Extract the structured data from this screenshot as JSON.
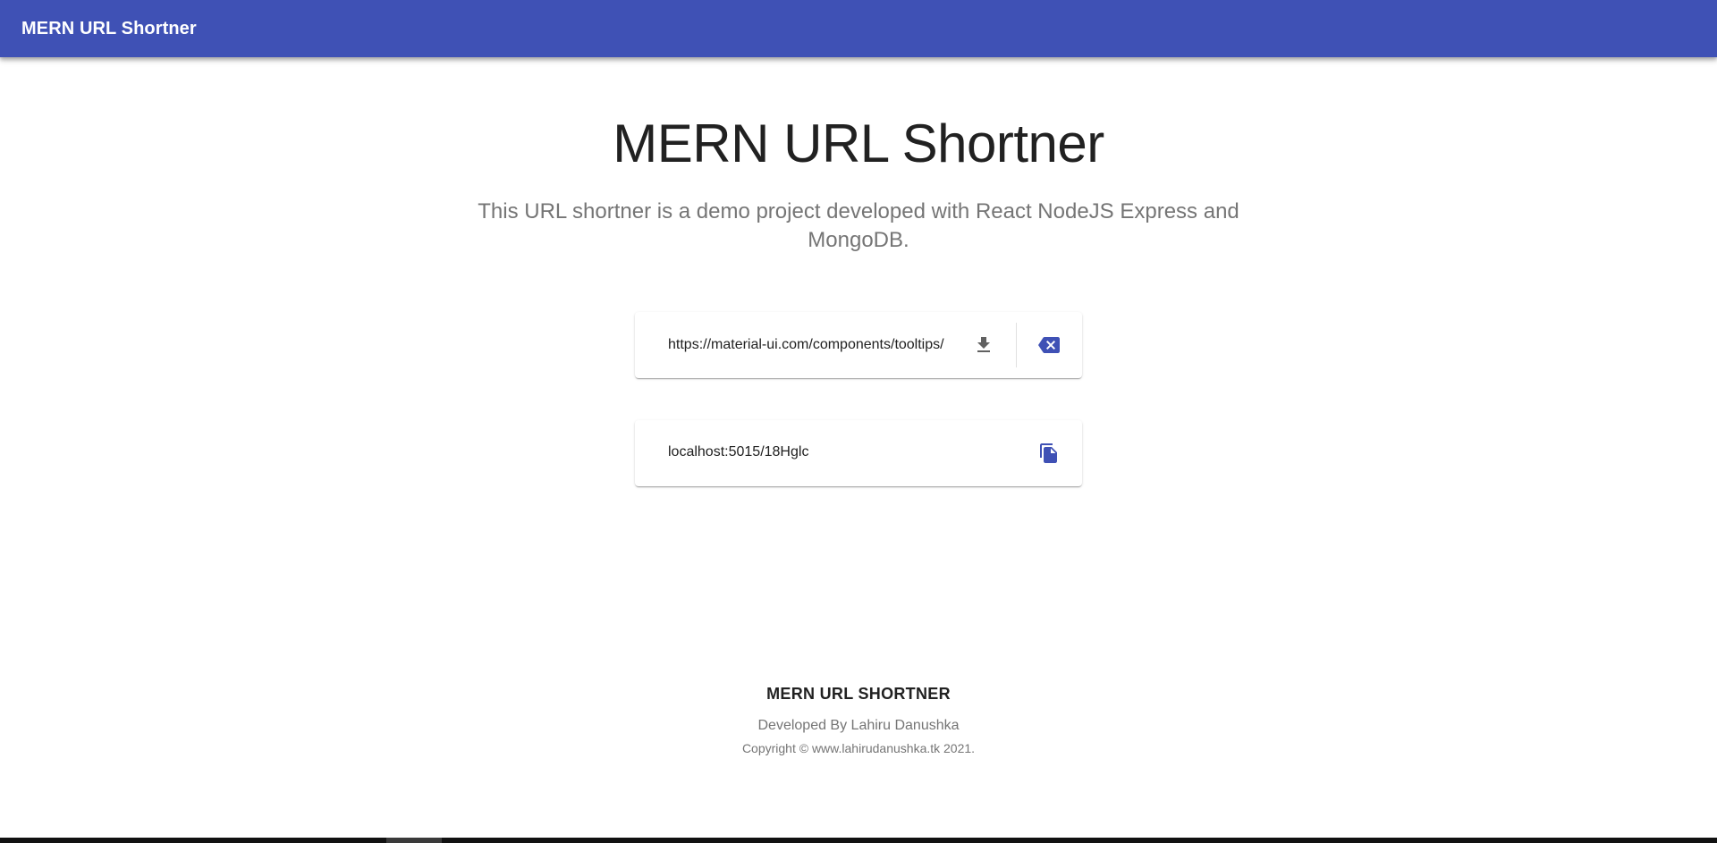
{
  "appbar": {
    "title": "MERN URL Shortner"
  },
  "hero": {
    "title": "MERN URL Shortner",
    "subtitle": "This URL shortner is a demo project developed with React NodeJS Express and MongoDB."
  },
  "url_card": {
    "input_value": "https://material-ui.com/components/tooltips/",
    "download_icon": "download-icon",
    "clear_icon": "backspace-clear-icon"
  },
  "short_card": {
    "short_url": "localhost:5015/18Hglc",
    "copy_icon": "copy-icon"
  },
  "footer": {
    "title": "MERN URL SHORTNER",
    "developer": "Developed By Lahiru Danushka",
    "copyright": "Copyright © www.lahirudanushka.tk 2021."
  },
  "colors": {
    "primary": "#3f51b5",
    "text_primary": "#212121",
    "text_secondary": "#757575",
    "icon_grey": "#616161"
  }
}
